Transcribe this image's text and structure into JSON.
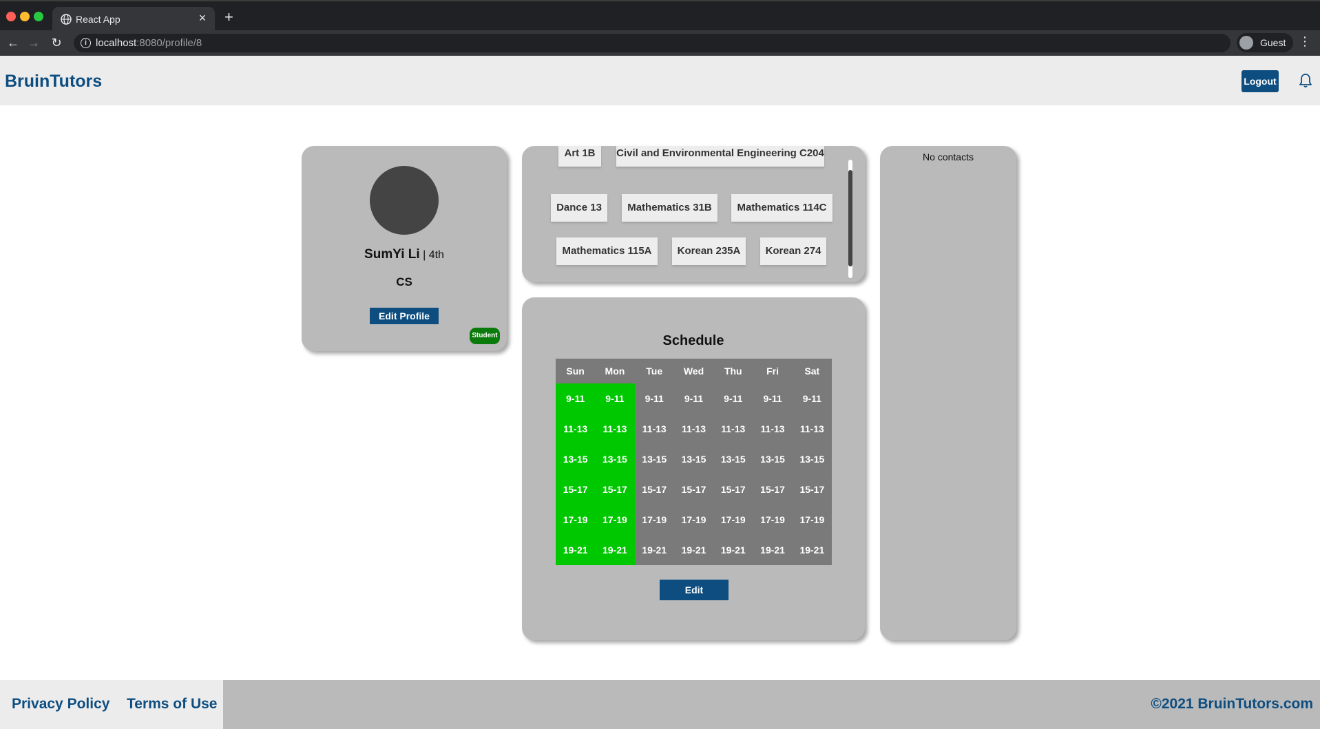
{
  "browser": {
    "tab_title": "React App",
    "tab_close": "×",
    "new_tab": "+",
    "url_host": "localhost",
    "url_path": ":8080/profile/8",
    "profile_label": "Guest"
  },
  "header": {
    "brand": "BruinTutors",
    "logout_label": "Logout"
  },
  "profile": {
    "name": "SumYi Li",
    "year_separator": " | ",
    "year": "4th",
    "major": "CS",
    "edit_label": "Edit Profile",
    "role_badge": "Student"
  },
  "classes": [
    "Art 1B",
    "Civil and Environmental Engineering C204",
    "Dance 13",
    "Mathematics 31B",
    "Mathematics 114C",
    "Mathematics 115A",
    "Korean 235A",
    "Korean 274"
  ],
  "schedule": {
    "title": "Schedule",
    "days": [
      "Sun",
      "Mon",
      "Tue",
      "Wed",
      "Thu",
      "Fri",
      "Sat"
    ],
    "slots": [
      "9-11",
      "11-13",
      "13-15",
      "15-17",
      "17-19",
      "19-21"
    ],
    "available_days": [
      "Sun",
      "Mon"
    ],
    "edit_label": "Edit"
  },
  "contacts": {
    "empty_text": "No contacts"
  },
  "footer": {
    "privacy_label": "Privacy Policy",
    "terms_label": "Terms of Use",
    "copyright": "©2021 BruinTutors.com"
  },
  "colors": {
    "brand": "#0d4d80",
    "available": "#00c800",
    "unavailable": "#7a7a7a",
    "card": "#bababa",
    "student_badge": "#0a7a0a"
  },
  "icons": [
    "globe-icon",
    "back-icon",
    "forward-icon",
    "reload-icon",
    "info-icon",
    "user-icon",
    "more-vert-icon",
    "bell-icon"
  ]
}
